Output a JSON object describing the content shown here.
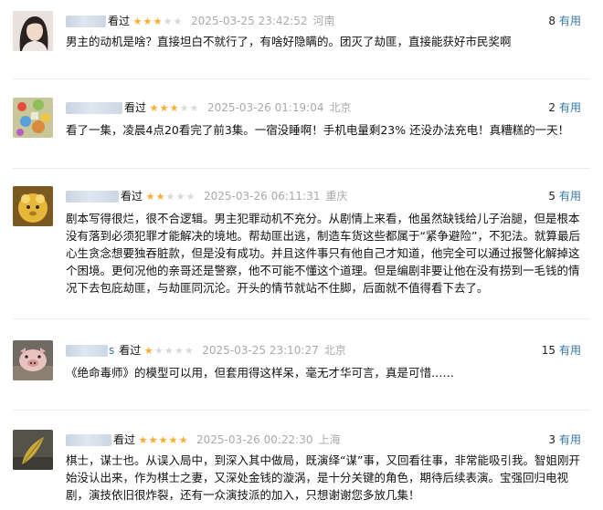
{
  "reviews": [
    {
      "name_suffix": "",
      "watched": "看过",
      "rating": 3,
      "date": "2025-03-25 23:42:52",
      "region": "河南",
      "useful_count": "8",
      "useful_label": "有用",
      "content": "男主的动机是啥？直接坦白不就行了，有啥好隐瞒的。团灭了劫匪，直接能获好市民奖啊"
    },
    {
      "name_suffix": "",
      "watched": "看过",
      "rating": 3,
      "date": "2025-03-26 01:19:04",
      "region": "北京",
      "useful_count": "2",
      "useful_label": "有用",
      "content": "看了一集，凌晨4点20看完了前3集。一宿没睡啊！手机电量剩23% 还没办法充电！真糟糕的一天！"
    },
    {
      "name_suffix": "",
      "watched": "看过",
      "rating": 2,
      "date": "2025-03-26 06:11:31",
      "region": "重庆",
      "useful_count": "5",
      "useful_label": "有用",
      "content": "剧本写得很烂，很不合逻辑。男主犯罪动机不充分。从剧情上来看，他虽然缺钱给儿子治腿，但是根本没有落到必须犯罪才能解决的境地。帮劫匪出逃，制造车货这些都属于“紧争避险”，不犯法。就算最后心生贪念想要独吞脏款，但是没有成功。并且这件事只有他自己才知道，他完全可以通过报警化解掉这个困境。更何况他的亲哥还是警察，他不可能不懂这个道理。但是编剧非要让他在没有捞到一毛钱的情况下去包庇劫匪，与劫匪同沉沦。开头的情节就站不住脚，后面就不值得看下去了。"
    },
    {
      "name_suffix": "s",
      "watched": "看过",
      "rating": 1,
      "date": "2025-03-25 23:10:27",
      "region": "北京",
      "useful_count": "15",
      "useful_label": "有用",
      "content": "《绝命毒师》的模型可以用，但套用得这样呆，毫无才华可言，真是可惜……"
    },
    {
      "name_suffix": "",
      "watched": "看过",
      "rating": 5,
      "date": "2025-03-26 00:22:30",
      "region": "上海",
      "useful_count": "3",
      "useful_label": "有用",
      "content": "棋士，谋士也。从误入局中，到深入其中做局，既演绎“谋”事，又回看往事，非常能吸引我。智姐刚开始没认出来，作为棋士之妻，又深处金钱的漩涡，是十分关键的角色，期待后续表演。宝强回归电视剧，演技依旧很炸裂，还有一众演技派的加入，只想谢谢您多放几集！"
    }
  ],
  "colors": {
    "star_on": "#ffac2d",
    "star_off": "#d9d9d9",
    "link": "#3377aa",
    "meta_gray": "#aaaaaa"
  }
}
